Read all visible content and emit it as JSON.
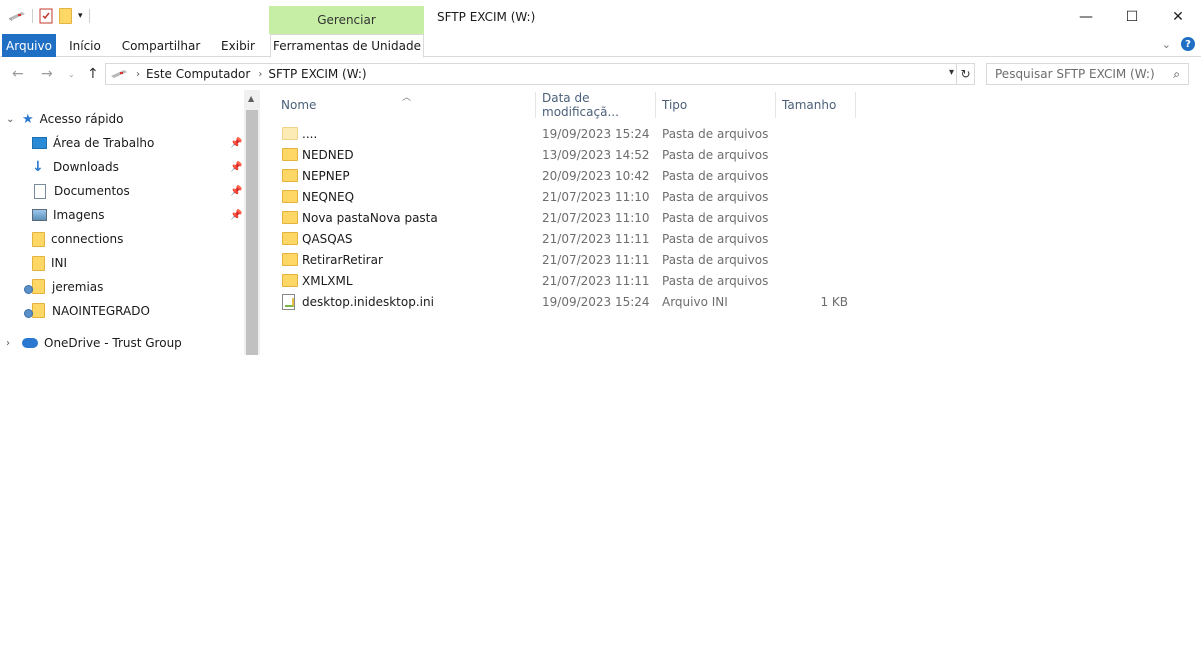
{
  "window": {
    "title": "SFTP EXCIM (W:)",
    "context_tab": "Gerenciar",
    "minimize": "—",
    "maximize": "☐",
    "close": "✕"
  },
  "ribbon": {
    "tabs": [
      "Arquivo",
      "Início",
      "Compartilhar",
      "Exibir",
      "Ferramentas de Unidade"
    ],
    "help": "?"
  },
  "address": {
    "path": [
      "Este Computador",
      "SFTP EXCIM (W:)"
    ],
    "search_placeholder": "Pesquisar SFTP EXCIM (W:)"
  },
  "navigation": {
    "quick_access": "Acesso rápido",
    "items": [
      {
        "label": "Área de Trabalho",
        "icon": "desktop-icon",
        "pinned": true
      },
      {
        "label": "Downloads",
        "icon": "download-icon",
        "pinned": true
      },
      {
        "label": "Documentos",
        "icon": "document-icon",
        "pinned": true
      },
      {
        "label": "Imagens",
        "icon": "image-icon",
        "pinned": true
      },
      {
        "label": "connections",
        "icon": "folder-icon",
        "pinned": false
      },
      {
        "label": "INI",
        "icon": "folder-icon",
        "pinned": false
      },
      {
        "label": "jeremias",
        "icon": "shared-folder-icon",
        "pinned": false
      },
      {
        "label": "NAOINTEGRADO",
        "icon": "shared-folder-icon",
        "pinned": false
      }
    ],
    "onedrive": "OneDrive - Trust Group"
  },
  "columns": [
    "Nome",
    "Data de modificaçã...",
    "Tipo",
    "Tamanho"
  ],
  "files": [
    {
      "name": "....",
      "date": "19/09/2023 15:24",
      "type": "Pasta de arquivos",
      "size": "",
      "icon": "folder-light"
    },
    {
      "name": "NEDNED",
      "date": "13/09/2023 14:52",
      "type": "Pasta de arquivos",
      "size": "",
      "icon": "folder"
    },
    {
      "name": "NEPNEP",
      "date": "20/09/2023 10:42",
      "type": "Pasta de arquivos",
      "size": "",
      "icon": "folder"
    },
    {
      "name": "NEQNEQ",
      "date": "21/07/2023 11:10",
      "type": "Pasta de arquivos",
      "size": "",
      "icon": "folder"
    },
    {
      "name": "Nova pastaNova pasta",
      "date": "21/07/2023 11:10",
      "type": "Pasta de arquivos",
      "size": "",
      "icon": "folder"
    },
    {
      "name": "QASQAS",
      "date": "21/07/2023 11:11",
      "type": "Pasta de arquivos",
      "size": "",
      "icon": "folder"
    },
    {
      "name": "RetirarRetirar",
      "date": "21/07/2023 11:11",
      "type": "Pasta de arquivos",
      "size": "",
      "icon": "folder"
    },
    {
      "name": "XMLXML",
      "date": "21/07/2023 11:11",
      "type": "Pasta de arquivos",
      "size": "",
      "icon": "folder"
    },
    {
      "name": "desktop.inidesktop.ini",
      "date": "19/09/2023 15:24",
      "type": "Arquivo INI",
      "size": "1 KB",
      "icon": "ini-file"
    }
  ]
}
